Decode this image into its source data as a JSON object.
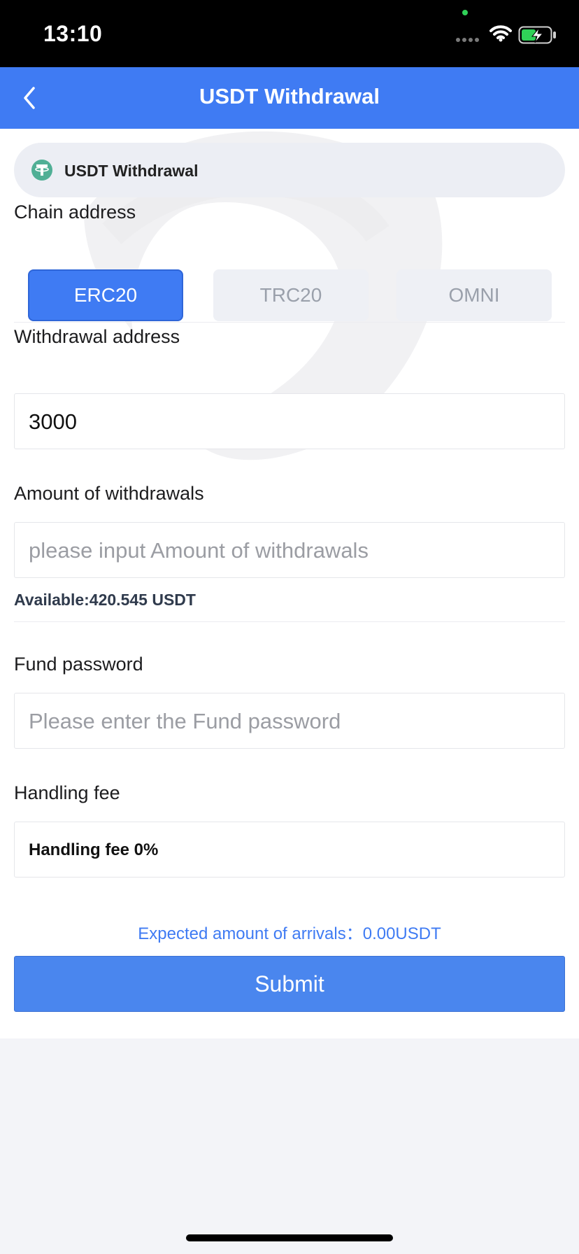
{
  "status_bar": {
    "time": "13:10"
  },
  "nav": {
    "title": "USDT Withdrawal"
  },
  "coin": {
    "name": "USDT Withdrawal"
  },
  "chain": {
    "label": "Chain address",
    "options": [
      {
        "label": "ERC20",
        "selected": true
      },
      {
        "label": "TRC20",
        "selected": false
      },
      {
        "label": "OMNI",
        "selected": false
      }
    ]
  },
  "withdrawal_address": {
    "label": "Withdrawal address",
    "value": "3000"
  },
  "amount": {
    "label": "Amount of withdrawals",
    "placeholder": "please input Amount of withdrawals",
    "available": "Available:420.545 USDT"
  },
  "fund_password": {
    "label": "Fund password",
    "placeholder": "Please enter the Fund password"
  },
  "handling_fee": {
    "label": "Handling fee",
    "value": "Handling fee 0%"
  },
  "expected": {
    "label": "Expected amount of arrivals：",
    "value": "0.00USDT"
  },
  "submit_label": "Submit",
  "colors": {
    "primary": "#3f7bf3",
    "active_chip": "#3f7bf3",
    "background": "#f3f4f8"
  }
}
